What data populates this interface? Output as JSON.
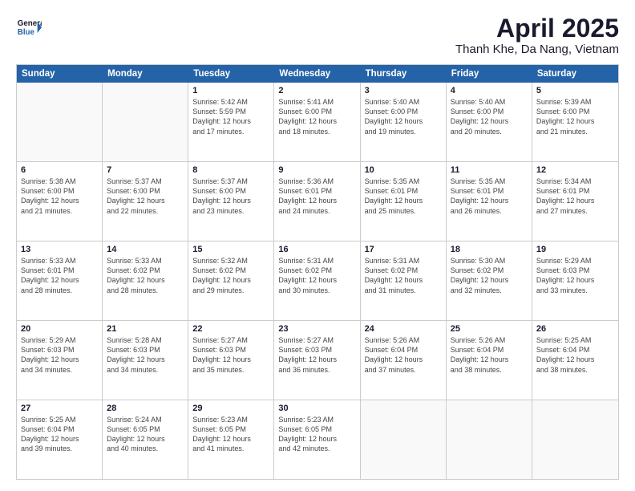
{
  "header": {
    "logo_line1": "General",
    "logo_line2": "Blue",
    "title": "April 2025",
    "subtitle": "Thanh Khe, Da Nang, Vietnam"
  },
  "calendar": {
    "weekdays": [
      "Sunday",
      "Monday",
      "Tuesday",
      "Wednesday",
      "Thursday",
      "Friday",
      "Saturday"
    ],
    "rows": [
      [
        {
          "day": "",
          "info": ""
        },
        {
          "day": "",
          "info": ""
        },
        {
          "day": "1",
          "info": "Sunrise: 5:42 AM\nSunset: 5:59 PM\nDaylight: 12 hours\nand 17 minutes."
        },
        {
          "day": "2",
          "info": "Sunrise: 5:41 AM\nSunset: 6:00 PM\nDaylight: 12 hours\nand 18 minutes."
        },
        {
          "day": "3",
          "info": "Sunrise: 5:40 AM\nSunset: 6:00 PM\nDaylight: 12 hours\nand 19 minutes."
        },
        {
          "day": "4",
          "info": "Sunrise: 5:40 AM\nSunset: 6:00 PM\nDaylight: 12 hours\nand 20 minutes."
        },
        {
          "day": "5",
          "info": "Sunrise: 5:39 AM\nSunset: 6:00 PM\nDaylight: 12 hours\nand 21 minutes."
        }
      ],
      [
        {
          "day": "6",
          "info": "Sunrise: 5:38 AM\nSunset: 6:00 PM\nDaylight: 12 hours\nand 21 minutes."
        },
        {
          "day": "7",
          "info": "Sunrise: 5:37 AM\nSunset: 6:00 PM\nDaylight: 12 hours\nand 22 minutes."
        },
        {
          "day": "8",
          "info": "Sunrise: 5:37 AM\nSunset: 6:00 PM\nDaylight: 12 hours\nand 23 minutes."
        },
        {
          "day": "9",
          "info": "Sunrise: 5:36 AM\nSunset: 6:01 PM\nDaylight: 12 hours\nand 24 minutes."
        },
        {
          "day": "10",
          "info": "Sunrise: 5:35 AM\nSunset: 6:01 PM\nDaylight: 12 hours\nand 25 minutes."
        },
        {
          "day": "11",
          "info": "Sunrise: 5:35 AM\nSunset: 6:01 PM\nDaylight: 12 hours\nand 26 minutes."
        },
        {
          "day": "12",
          "info": "Sunrise: 5:34 AM\nSunset: 6:01 PM\nDaylight: 12 hours\nand 27 minutes."
        }
      ],
      [
        {
          "day": "13",
          "info": "Sunrise: 5:33 AM\nSunset: 6:01 PM\nDaylight: 12 hours\nand 28 minutes."
        },
        {
          "day": "14",
          "info": "Sunrise: 5:33 AM\nSunset: 6:02 PM\nDaylight: 12 hours\nand 28 minutes."
        },
        {
          "day": "15",
          "info": "Sunrise: 5:32 AM\nSunset: 6:02 PM\nDaylight: 12 hours\nand 29 minutes."
        },
        {
          "day": "16",
          "info": "Sunrise: 5:31 AM\nSunset: 6:02 PM\nDaylight: 12 hours\nand 30 minutes."
        },
        {
          "day": "17",
          "info": "Sunrise: 5:31 AM\nSunset: 6:02 PM\nDaylight: 12 hours\nand 31 minutes."
        },
        {
          "day": "18",
          "info": "Sunrise: 5:30 AM\nSunset: 6:02 PM\nDaylight: 12 hours\nand 32 minutes."
        },
        {
          "day": "19",
          "info": "Sunrise: 5:29 AM\nSunset: 6:03 PM\nDaylight: 12 hours\nand 33 minutes."
        }
      ],
      [
        {
          "day": "20",
          "info": "Sunrise: 5:29 AM\nSunset: 6:03 PM\nDaylight: 12 hours\nand 34 minutes."
        },
        {
          "day": "21",
          "info": "Sunrise: 5:28 AM\nSunset: 6:03 PM\nDaylight: 12 hours\nand 34 minutes."
        },
        {
          "day": "22",
          "info": "Sunrise: 5:27 AM\nSunset: 6:03 PM\nDaylight: 12 hours\nand 35 minutes."
        },
        {
          "day": "23",
          "info": "Sunrise: 5:27 AM\nSunset: 6:03 PM\nDaylight: 12 hours\nand 36 minutes."
        },
        {
          "day": "24",
          "info": "Sunrise: 5:26 AM\nSunset: 6:04 PM\nDaylight: 12 hours\nand 37 minutes."
        },
        {
          "day": "25",
          "info": "Sunrise: 5:26 AM\nSunset: 6:04 PM\nDaylight: 12 hours\nand 38 minutes."
        },
        {
          "day": "26",
          "info": "Sunrise: 5:25 AM\nSunset: 6:04 PM\nDaylight: 12 hours\nand 38 minutes."
        }
      ],
      [
        {
          "day": "27",
          "info": "Sunrise: 5:25 AM\nSunset: 6:04 PM\nDaylight: 12 hours\nand 39 minutes."
        },
        {
          "day": "28",
          "info": "Sunrise: 5:24 AM\nSunset: 6:05 PM\nDaylight: 12 hours\nand 40 minutes."
        },
        {
          "day": "29",
          "info": "Sunrise: 5:23 AM\nSunset: 6:05 PM\nDaylight: 12 hours\nand 41 minutes."
        },
        {
          "day": "30",
          "info": "Sunrise: 5:23 AM\nSunset: 6:05 PM\nDaylight: 12 hours\nand 42 minutes."
        },
        {
          "day": "",
          "info": ""
        },
        {
          "day": "",
          "info": ""
        },
        {
          "day": "",
          "info": ""
        }
      ]
    ]
  }
}
